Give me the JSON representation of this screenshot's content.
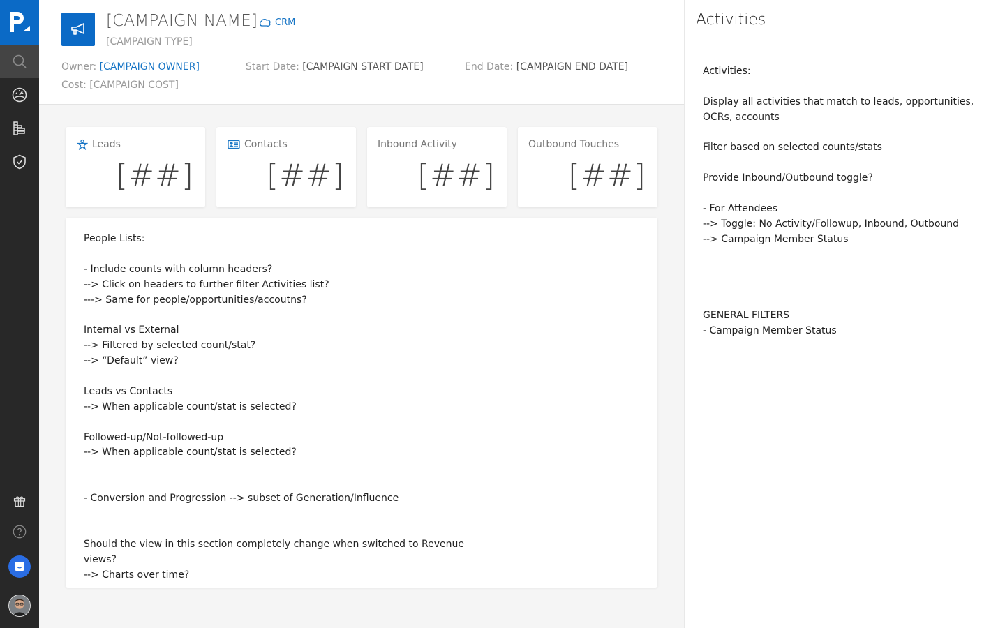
{
  "sidebar": {
    "logo_label": "p.",
    "nav": [
      {
        "name": "search",
        "icon": "search-icon",
        "active": true
      },
      {
        "name": "dashboard",
        "icon": "speedometer-icon",
        "active": false
      },
      {
        "name": "reports",
        "icon": "list-bars-icon",
        "active": false
      },
      {
        "name": "security",
        "icon": "shield-check-icon",
        "active": false
      }
    ],
    "bottom": [
      {
        "name": "gifts",
        "icon": "gift-icon"
      },
      {
        "name": "help",
        "icon": "question-circle-icon"
      },
      {
        "name": "chat",
        "icon": "chat-icon"
      },
      {
        "name": "profile",
        "icon": "avatar"
      }
    ]
  },
  "header": {
    "campaign_name": "[CAMPAIGN NAME]",
    "crm_link": "CRM",
    "campaign_type": "[CAMPAIGN TYPE]",
    "owner_label": "Owner:",
    "owner_value": "[CAMPAIGN OWNER]",
    "start_label": "Start Date:",
    "start_value": "[CAMPAIGN START DATE]",
    "end_label": "End Date:",
    "end_value": "[CAMPAIGN END DATE]",
    "cost_label": "Cost:",
    "cost_value": "[CAMPAIGN COST]"
  },
  "stats": [
    {
      "label": "Leads",
      "value": "[##]",
      "icon": "lead-icon"
    },
    {
      "label": "Contacts",
      "value": "[##]",
      "icon": "contact-card-icon"
    },
    {
      "label": "Inbound Activity",
      "value": "[##]"
    },
    {
      "label": "Outbound Touches",
      "value": "[##]"
    }
  ],
  "notes": {
    "lines": [
      "People Lists:",
      "",
      "- Include counts with column headers?",
      "--> Click on headers to further filter Activities list?",
      "---> Same for people/opportunities/accoutns?",
      "",
      "Internal vs External",
      "--> Filtered by selected count/stat?",
      "--> “Default” view?",
      "",
      "Leads vs Contacts",
      "--> When applicable count/stat is selected?",
      "",
      "Followed-up/Not-followed-up",
      "--> When applicable count/stat is selected?",
      "",
      "",
      "- Conversion and Progression --> subset of Generation/Influence",
      "",
      "",
      "Should the view in this section completely change when switched to Revenue",
      "views?",
      "--> Charts over time?"
    ]
  },
  "activities": {
    "title": "Activities",
    "lines": [
      "Activities:",
      "",
      "Display all activities that match to leads, opportunities,",
      "OCRs, accounts",
      "",
      "Filter based on selected counts/stats",
      "",
      "Provide Inbound/Outbound toggle?",
      "",
      "- For Attendees",
      "--> Toggle: No Activity/Followup, Inbound, Outbound",
      "--> Campaign Member Status",
      "",
      "",
      "",
      "",
      "GENERAL FILTERS",
      "- Campaign Member Status"
    ]
  },
  "colors": {
    "brand": "#0b6ac6",
    "link": "#1976c6",
    "sidebar": "#282828",
    "chat": "#2a6de4"
  }
}
